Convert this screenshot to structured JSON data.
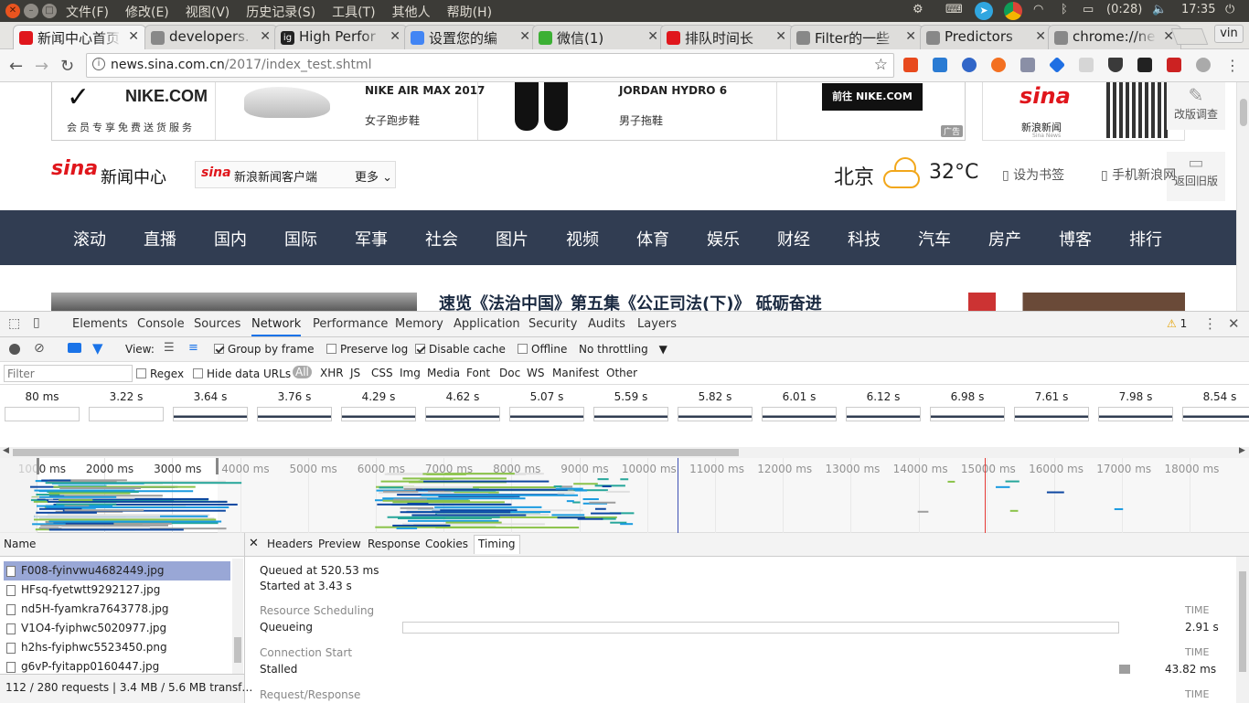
{
  "os": {
    "menu": [
      "文件(F)",
      "修改(E)",
      "视图(V)",
      "历史记录(S)",
      "工具(T)",
      "其他人",
      "帮助(H)"
    ],
    "battery": "(0:28)",
    "clock": "17:35"
  },
  "tabs": [
    {
      "title": "新闻中心首页",
      "icon_color": "#e0161c",
      "icon": "sina-icon"
    },
    {
      "title": "developers.",
      "icon_color": "#888",
      "icon": "page-icon"
    },
    {
      "title": "High Perfor",
      "icon_color": "#222",
      "icon": "ig-icon",
      "icon_text": "ig"
    },
    {
      "title": "设置您的编",
      "icon_color": "#4285f4",
      "icon": "google-icon"
    },
    {
      "title": "微信(1)",
      "icon_color": "#3cb034",
      "icon": "wechat-icon"
    },
    {
      "title": "排队时间长",
      "icon_color": "#e0161c",
      "icon": "weibo-icon"
    },
    {
      "title": "Filter的一些",
      "icon_color": "#888",
      "icon": "page-icon"
    },
    {
      "title": "Predictors",
      "icon_color": "#888",
      "icon": "page-icon"
    },
    {
      "title": "chrome://ne",
      "icon_color": "#888",
      "icon": "page-icon"
    }
  ],
  "profile_label": "vin",
  "address": {
    "host": "news.sina.com.cn",
    "path": "/2017/index_test.shtml"
  },
  "page": {
    "ad": {
      "brand": "NIKE.COM",
      "tagline": "会员专享免费送货服务",
      "product1_name": "NIKE AIR MAX 2017",
      "product1_sub": "女子跑步鞋",
      "product2_name": "JORDAN HYDRO 6",
      "product2_sub": "男子拖鞋",
      "cta": "前往 NIKE.COM",
      "ad_tag": "广告"
    },
    "qr_caption": "新浪新闻",
    "qr_sub": "Sina News",
    "side_btn1": "改版调查",
    "side_btn2": "返回旧版",
    "logo_text": "新闻中心",
    "client_btn": "新浪新闻客户端",
    "more_btn": "更多",
    "city": "北京",
    "temperature": "32°C",
    "bookmark": "设为书签",
    "mobile": "手机新浪网",
    "nav": [
      "滚动",
      "直播",
      "国内",
      "国际",
      "军事",
      "社会",
      "图片",
      "视频",
      "体育",
      "娱乐",
      "财经",
      "科技",
      "汽车",
      "房产",
      "博客",
      "排行"
    ],
    "headline": "速览《法治中国》第五集《公正司法(下)》  砥砺奋进"
  },
  "devtools": {
    "tabs": [
      "Elements",
      "Console",
      "Sources",
      "Network",
      "Performance",
      "Memory",
      "Application",
      "Security",
      "Audits",
      "Layers"
    ],
    "active_tab": "Network",
    "warning_count": "1",
    "toolbar": {
      "view_label": "View:",
      "group_by_frame": "Group by frame",
      "preserve_log": "Preserve log",
      "disable_cache": "Disable cache",
      "offline": "Offline",
      "throttling": "No throttling"
    },
    "filter": {
      "placeholder": "Filter",
      "regex": "Regex",
      "hide_data_urls": "Hide data URLs",
      "types": [
        "All",
        "XHR",
        "JS",
        "CSS",
        "Img",
        "Media",
        "Font",
        "Doc",
        "WS",
        "Manifest",
        "Other"
      ]
    },
    "screenshots": [
      "80 ms",
      "3.22 s",
      "3.64 s",
      "3.76 s",
      "4.29 s",
      "4.62 s",
      "5.07 s",
      "5.59 s",
      "5.82 s",
      "6.01 s",
      "6.12 s",
      "6.98 s",
      "7.61 s",
      "7.98 s",
      "8.54 s"
    ],
    "timeline_ticks": [
      "1000 ms",
      "2000 ms",
      "3000 ms",
      "4000 ms",
      "5000 ms",
      "6000 ms",
      "7000 ms",
      "8000 ms",
      "9000 ms",
      "10000 ms",
      "11000 ms",
      "12000 ms",
      "13000 ms",
      "14000 ms",
      "15000 ms",
      "16000 ms",
      "17000 ms",
      "18000 ms"
    ],
    "name_header": "Name",
    "requests": [
      "F008-fyinvwu4682449.jpg",
      "HFsq-fyetwtt9292127.jpg",
      "nd5H-fyamkra7643778.jpg",
      "V1O4-fyiphwc5020977.jpg",
      "h2hs-fyiphwc5523450.png",
      "g6vP-fyitapp0160447.jpg"
    ],
    "selected_request": 0,
    "status": "112 / 280 requests  |  3.4 MB / 5.6 MB transf…",
    "detail_tabs": [
      "Headers",
      "Preview",
      "Response",
      "Cookies",
      "Timing"
    ],
    "active_detail_tab": "Timing",
    "timing": {
      "queued": "Queued at 520.53 ms",
      "started": "Started at 3.43 s",
      "sections": [
        {
          "title": "Resource Scheduling",
          "time_header": "TIME",
          "label": "Queueing",
          "value": "2.91 s"
        },
        {
          "title": "Connection Start",
          "time_header": "TIME",
          "label": "Stalled",
          "value": "43.82 ms"
        },
        {
          "title": "Request/Response",
          "time_header": "TIME"
        }
      ]
    }
  }
}
